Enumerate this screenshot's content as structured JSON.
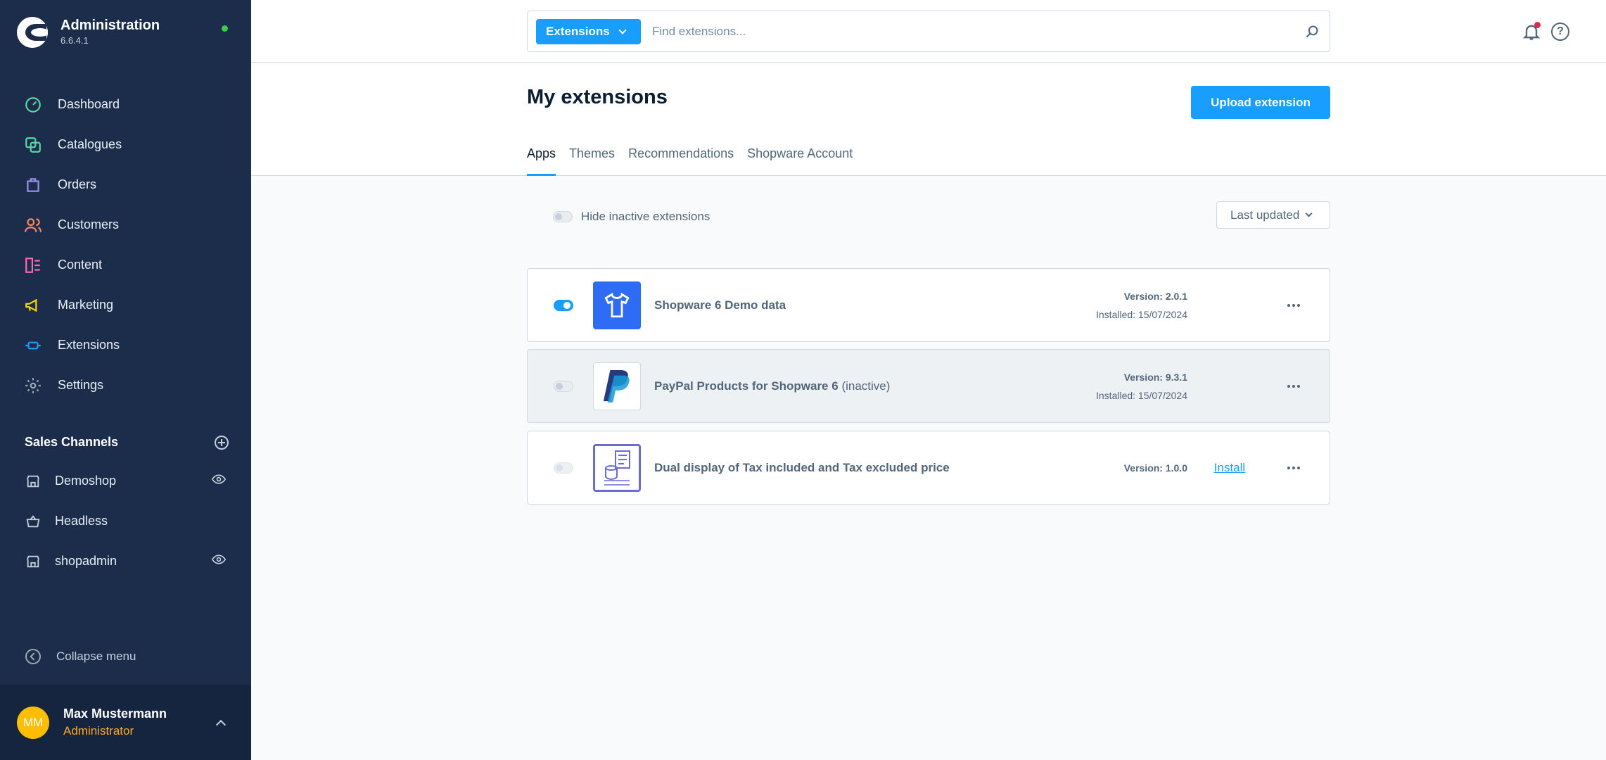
{
  "brand": {
    "title": "Administration",
    "version": "6.6.4.1"
  },
  "nav": [
    {
      "label": "Dashboard",
      "icon": "dashboard-icon",
      "color": "#57d9a3"
    },
    {
      "label": "Catalogues",
      "icon": "catalogue-icon",
      "color": "#57d9a3"
    },
    {
      "label": "Orders",
      "icon": "orders-icon",
      "color": "#a092f0"
    },
    {
      "label": "Customers",
      "icon": "customers-icon",
      "color": "#f88962"
    },
    {
      "label": "Content",
      "icon": "content-icon",
      "color": "#ff68b4"
    },
    {
      "label": "Marketing",
      "icon": "marketing-icon",
      "color": "#ffd700"
    },
    {
      "label": "Extensions",
      "icon": "extensions-icon",
      "color": "#189eff"
    },
    {
      "label": "Settings",
      "icon": "settings-icon",
      "color": "#9aa8b5"
    }
  ],
  "sales_channels": {
    "title": "Sales Channels",
    "items": [
      {
        "label": "Demoshop",
        "icon": "storefront-icon",
        "visible": true
      },
      {
        "label": "Headless",
        "icon": "basket-icon",
        "visible": false
      },
      {
        "label": "shopadmin",
        "icon": "storefront-icon",
        "visible": true
      }
    ]
  },
  "collapse_label": "Collapse menu",
  "user": {
    "initials": "MM",
    "name": "Max Mustermann",
    "role": "Administrator"
  },
  "search": {
    "type_label": "Extensions",
    "placeholder": "Find extensions..."
  },
  "page": {
    "title": "My extensions",
    "upload_label": "Upload extension",
    "tabs": [
      "Apps",
      "Themes",
      "Recommendations",
      "Shopware Account"
    ],
    "active_tab": "Apps"
  },
  "filter": {
    "hide_inactive_label": "Hide inactive extensions",
    "hide_inactive": false,
    "sort_label": "Last updated"
  },
  "extensions": [
    {
      "name": "Shopware 6 Demo data",
      "status": "",
      "active": true,
      "version": "Version: 2.0.1",
      "installed": "Installed: 15/07/2024",
      "action": ""
    },
    {
      "name": "PayPal Products for Shopware 6",
      "status": "(inactive)",
      "active": false,
      "version": "Version: 9.3.1",
      "installed": "Installed: 15/07/2024",
      "action": ""
    },
    {
      "name": "Dual display of Tax included and Tax excluded price",
      "status": "",
      "active": false,
      "version": "Version: 1.0.0",
      "installed": "",
      "action": "Install"
    }
  ],
  "colors": {
    "accent": "#189eff",
    "sidebar": "#1b2d4a",
    "warning": "#ffab22",
    "notification": "#de294c"
  }
}
